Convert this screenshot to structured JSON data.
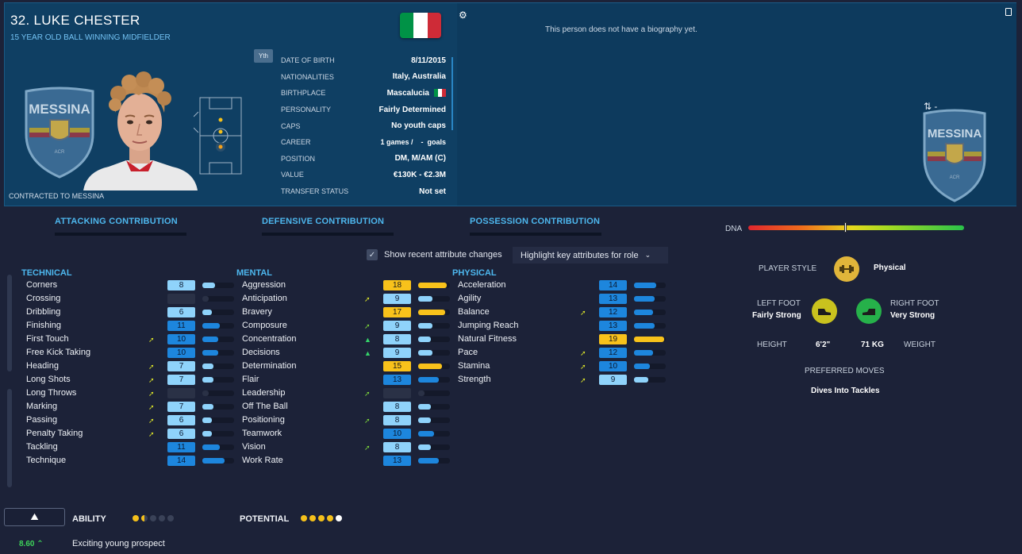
{
  "player": {
    "name": "32. LUKE CHESTER",
    "role": "15 YEAR OLD BALL WINNING MIDFIELDER",
    "youth_badge": "Yth",
    "contracted": "CONTRACTED TO MESSINA",
    "club_crest_text": "MESSINA",
    "flag_colors": [
      "#009246",
      "#ffffff",
      "#ce2b37"
    ]
  },
  "info": [
    {
      "label": "DATE OF BIRTH",
      "value": "8/11/2015"
    },
    {
      "label": "NATIONALITIES",
      "value": "Italy, Australia"
    },
    {
      "label": "BIRTHPLACE",
      "value": "Mascalucia"
    },
    {
      "label": "PERSONALITY",
      "value": "Fairly Determined"
    },
    {
      "label": "CAPS",
      "value": "No youth caps"
    },
    {
      "label": "CAREER",
      "value": "1 games /    -  goals"
    },
    {
      "label": "POSITION",
      "value": "DM, M/AM (C)"
    },
    {
      "label": "VALUE",
      "value": "€130K - €2.3M"
    },
    {
      "label": "TRANSFER STATUS",
      "value": "Not set"
    }
  ],
  "bio": "This person does not have a biography yet.",
  "swap_text": "-",
  "contributions": [
    "ATTACKING CONTRIBUTION",
    "DEFENSIVE CONTRIBUTION",
    "POSSESSION CONTRIBUTION"
  ],
  "dna_label": "DNA",
  "show_recent_label": "Show recent attribute changes",
  "highlight_label": "Highlight key attributes for role",
  "columns": {
    "technical": {
      "title": "TECHNICAL",
      "attrs": [
        {
          "name": "Corners",
          "value": "8",
          "arrow": ""
        },
        {
          "name": "Crossing",
          "value": "",
          "arrow": ""
        },
        {
          "name": "Dribbling",
          "value": "6",
          "arrow": ""
        },
        {
          "name": "Finishing",
          "value": "11",
          "arrow": ""
        },
        {
          "name": "First Touch",
          "value": "10",
          "arrow": "up-yellow"
        },
        {
          "name": "Free Kick Taking",
          "value": "10",
          "arrow": ""
        },
        {
          "name": "Heading",
          "value": "7",
          "arrow": "up-yellow"
        },
        {
          "name": "Long Shots",
          "value": "7",
          "arrow": "up-yellow"
        },
        {
          "name": "Long Throws",
          "value": "",
          "arrow": "up-yellow"
        },
        {
          "name": "Marking",
          "value": "7",
          "arrow": "up-yellow"
        },
        {
          "name": "Passing",
          "value": "6",
          "arrow": "up-yellow"
        },
        {
          "name": "Penalty Taking",
          "value": "6",
          "arrow": "up-yellow"
        },
        {
          "name": "Tackling",
          "value": "11",
          "arrow": ""
        },
        {
          "name": "Technique",
          "value": "14",
          "arrow": ""
        }
      ]
    },
    "mental": {
      "title": "MENTAL",
      "attrs": [
        {
          "name": "Aggression",
          "value": "18",
          "arrow": ""
        },
        {
          "name": "Anticipation",
          "value": "9",
          "arrow": "up-yellow"
        },
        {
          "name": "Bravery",
          "value": "17",
          "arrow": ""
        },
        {
          "name": "Composure",
          "value": "9",
          "arrow": "up-green"
        },
        {
          "name": "Concentration",
          "value": "8",
          "arrow": "up-green2"
        },
        {
          "name": "Decisions",
          "value": "9",
          "arrow": "up-green2"
        },
        {
          "name": "Determination",
          "value": "15",
          "arrow": ""
        },
        {
          "name": "Flair",
          "value": "13",
          "arrow": ""
        },
        {
          "name": "Leadership",
          "value": "",
          "arrow": "up-green"
        },
        {
          "name": "Off The Ball",
          "value": "8",
          "arrow": ""
        },
        {
          "name": "Positioning",
          "value": "8",
          "arrow": "up-green"
        },
        {
          "name": "Teamwork",
          "value": "10",
          "arrow": ""
        },
        {
          "name": "Vision",
          "value": "8",
          "arrow": "up-green"
        },
        {
          "name": "Work Rate",
          "value": "13",
          "arrow": ""
        }
      ]
    },
    "physical": {
      "title": "PHYSICAL",
      "attrs": [
        {
          "name": "Acceleration",
          "value": "14",
          "arrow": ""
        },
        {
          "name": "Agility",
          "value": "13",
          "arrow": ""
        },
        {
          "name": "Balance",
          "value": "12",
          "arrow": "up-yellow"
        },
        {
          "name": "Jumping Reach",
          "value": "13",
          "arrow": ""
        },
        {
          "name": "Natural Fitness",
          "value": "19",
          "arrow": ""
        },
        {
          "name": "Pace",
          "value": "12",
          "arrow": "up-yellow"
        },
        {
          "name": "Stamina",
          "value": "10",
          "arrow": "up-yellow"
        },
        {
          "name": "Strength",
          "value": "9",
          "arrow": "up-yellow"
        }
      ]
    }
  },
  "profile": {
    "player_style_label": "PLAYER STYLE",
    "player_style_value": "Physical",
    "left_foot_label": "LEFT FOOT",
    "left_foot_value": "Fairly Strong",
    "right_foot_label": "RIGHT FOOT",
    "right_foot_value": "Very Strong",
    "height_label": "HEIGHT",
    "height_value": "6'2\"",
    "weight_value": "71 KG",
    "weight_label": "WEIGHT",
    "preferred_moves_label": "PREFERRED MOVES",
    "preferred_moves_value": "Dives Into Tackles"
  },
  "bottom": {
    "ability_label": "ABILITY",
    "potential_label": "POTENTIAL",
    "ability_stars": 1.5,
    "potential_stars": 5,
    "rating": "8.60",
    "prospect": "Exciting young prospect"
  },
  "colors": {
    "accent": "#4db7ee",
    "header_bg": "#0f3f63",
    "bar_light": "#8fd3fb",
    "bar_mid": "#1d86dd",
    "bar_gold": "#f8c21b"
  }
}
